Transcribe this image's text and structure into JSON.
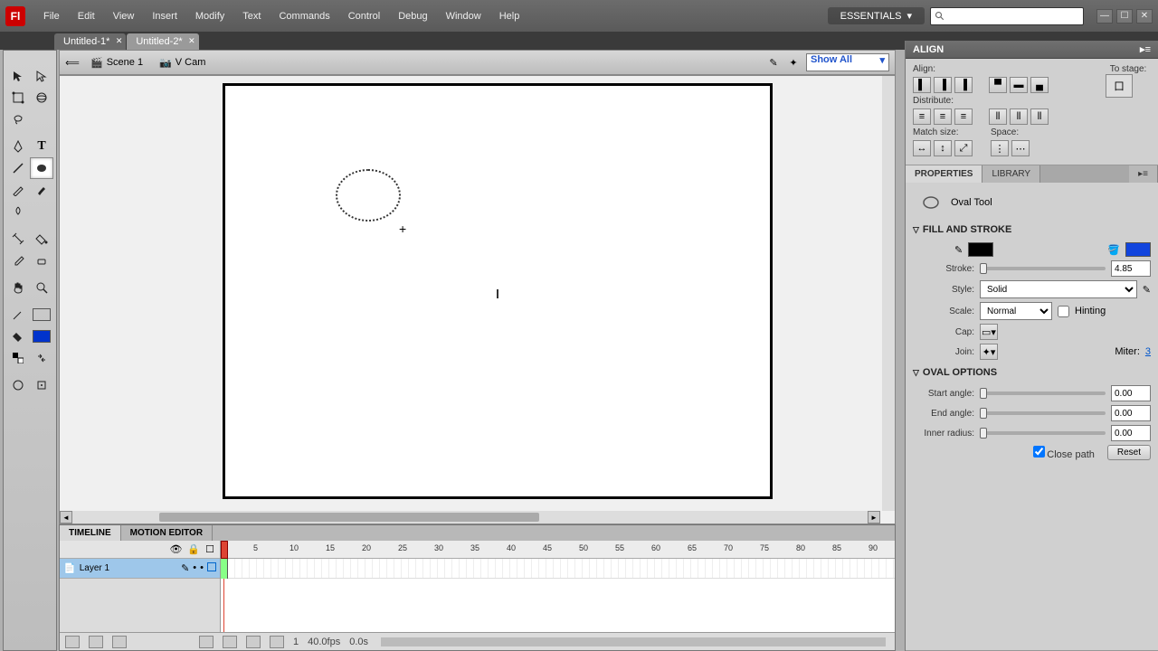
{
  "app_icon": "Fl",
  "menu": [
    "File",
    "Edit",
    "View",
    "Insert",
    "Modify",
    "Text",
    "Commands",
    "Control",
    "Debug",
    "Window",
    "Help"
  ],
  "workspace": "ESSENTIALS",
  "doc_tabs": [
    {
      "label": "Untitled-1*",
      "active": false
    },
    {
      "label": "Untitled-2*",
      "active": true
    }
  ],
  "edit_bar": {
    "scene": "Scene 1",
    "vcam": "V Cam",
    "zoom": "Show All"
  },
  "tools": {
    "stroke_color": "#000000",
    "fill_color": "#0033cc"
  },
  "align_panel": {
    "title": "ALIGN",
    "align_label": "Align:",
    "distribute_label": "Distribute:",
    "match_label": "Match size:",
    "space_label": "Space:",
    "to_stage_label": "To stage:"
  },
  "prop_panel": {
    "tabs": [
      "PROPERTIES",
      "LIBRARY"
    ],
    "tool_name": "Oval Tool",
    "sections": {
      "fill_stroke": "FILL AND STROKE",
      "oval_options": "OVAL OPTIONS"
    },
    "stroke_label": "Stroke:",
    "stroke_value": "4.85",
    "style_label": "Style:",
    "style_value": "Solid",
    "scale_label": "Scale:",
    "scale_value": "Normal",
    "hinting_label": "Hinting",
    "cap_label": "Cap:",
    "join_label": "Join:",
    "miter_label": "Miter:",
    "miter_value": "3",
    "start_angle_label": "Start angle:",
    "start_angle_value": "0.00",
    "end_angle_label": "End angle:",
    "end_angle_value": "0.00",
    "inner_radius_label": "Inner radius:",
    "inner_radius_value": "0.00",
    "close_path_label": "Close path",
    "reset_label": "Reset",
    "stroke_color": "#000000",
    "fill_color": "#1144dd"
  },
  "timeline": {
    "tabs": [
      "TIMELINE",
      "MOTION EDITOR"
    ],
    "layer_name": "Layer 1",
    "ruler_marks": [
      5,
      10,
      15,
      20,
      25,
      30,
      35,
      40,
      45,
      50,
      55,
      60,
      65,
      70,
      75,
      80,
      85,
      90
    ],
    "footer_fps": "40.0fps",
    "footer_time": "0.0s",
    "footer_frame": "1"
  }
}
